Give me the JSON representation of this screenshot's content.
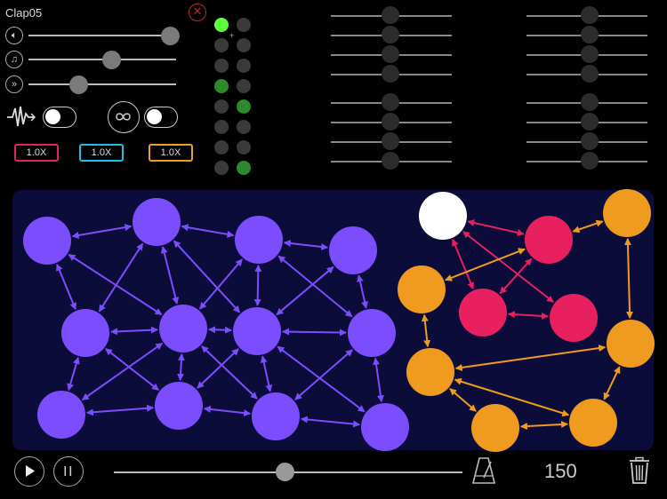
{
  "header": {
    "title": "Clap05",
    "close_icon": "close-icon"
  },
  "sliders": [
    {
      "name": "volume",
      "icon": "speaker",
      "glyph": "🔈︎",
      "value": 0.96
    },
    {
      "name": "pitch",
      "icon": "music-note",
      "glyph": "♫",
      "value": 0.56
    },
    {
      "name": "speed",
      "icon": "fast-forward",
      "glyph": "»",
      "value": 0.34
    }
  ],
  "toggles": [
    {
      "name": "pulse",
      "icon": "pulse-wave",
      "on": false
    },
    {
      "name": "loop",
      "icon": "infinity",
      "on": false
    }
  ],
  "speed_buttons": [
    {
      "label": "1.0X",
      "color": "#e0245e"
    },
    {
      "label": "1.0X",
      "color": "#1ec0e8"
    },
    {
      "label": "1.0X",
      "color": "#f0a020"
    }
  ],
  "led_grid": {
    "on_colors": {
      "bright": "#5dff3c",
      "green": "#2c8a2c"
    },
    "cells": [
      [
        "bright",
        "off"
      ],
      [
        "off",
        "off"
      ],
      [
        "off",
        "off"
      ],
      [
        "green",
        "off"
      ],
      [
        "off",
        "green"
      ],
      [
        "off",
        "off"
      ],
      [
        "off",
        "off"
      ],
      [
        "off",
        "green"
      ]
    ]
  },
  "mixer": {
    "groups": [
      {
        "levels": [
          0.49,
          0.49,
          0.49,
          0.49
        ]
      },
      {
        "levels": [
          0.49,
          0.49,
          0.49,
          0.49
        ]
      },
      {
        "levels": [
          0.52,
          0.52,
          0.52,
          0.52
        ]
      },
      {
        "levels": [
          0.52,
          0.52,
          0.52,
          0.52
        ]
      }
    ]
  },
  "graph": {
    "colors": {
      "purple": "#7c4dff",
      "pink": "#e8205f",
      "orange": "#ef9b20",
      "white": "#ffffff"
    },
    "nodes": [
      {
        "color": "purple"
      },
      {
        "color": "purple"
      },
      {
        "color": "purple"
      },
      {
        "color": "purple"
      },
      {
        "color": "purple"
      },
      {
        "color": "purple"
      },
      {
        "color": "purple"
      },
      {
        "color": "purple"
      },
      {
        "color": "purple"
      },
      {
        "color": "purple"
      },
      {
        "color": "purple"
      },
      {
        "color": "purple"
      },
      {
        "color": "white"
      },
      {
        "color": "pink"
      },
      {
        "color": "pink"
      },
      {
        "color": "pink"
      },
      {
        "color": "orange"
      },
      {
        "color": "orange"
      },
      {
        "color": "orange"
      },
      {
        "color": "orange"
      },
      {
        "color": "orange"
      },
      {
        "color": "orange"
      }
    ]
  },
  "transport": {
    "play_icon": "play-icon",
    "pause_icon": "pause-icon",
    "position": 0.49,
    "metronome_icon": "metronome-icon",
    "bpm": "150",
    "trash_icon": "trash-icon"
  }
}
